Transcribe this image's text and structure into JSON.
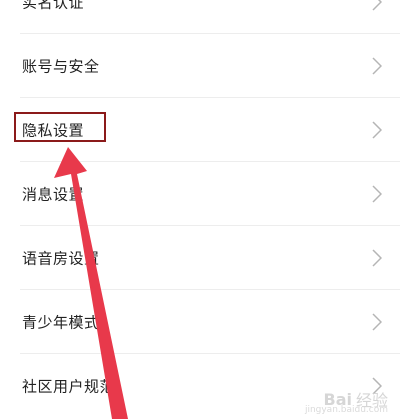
{
  "settings": {
    "items": [
      {
        "label": "实名认证"
      },
      {
        "label": "账号与安全"
      },
      {
        "label": "隐私设置"
      },
      {
        "label": "消息设置"
      },
      {
        "label": "语音房设置"
      },
      {
        "label": "青少年模式"
      },
      {
        "label": "社区用户规范"
      }
    ],
    "highlighted_item": "隐私设置"
  },
  "annotation": {
    "box_color": "#8b1a1a",
    "arrow_color": "#e8394b"
  },
  "watermark": {
    "logo": "Bai",
    "text": "经验",
    "url": "jingyan.baidu.com"
  },
  "icons": {
    "chevron": "chevron-right-icon"
  }
}
